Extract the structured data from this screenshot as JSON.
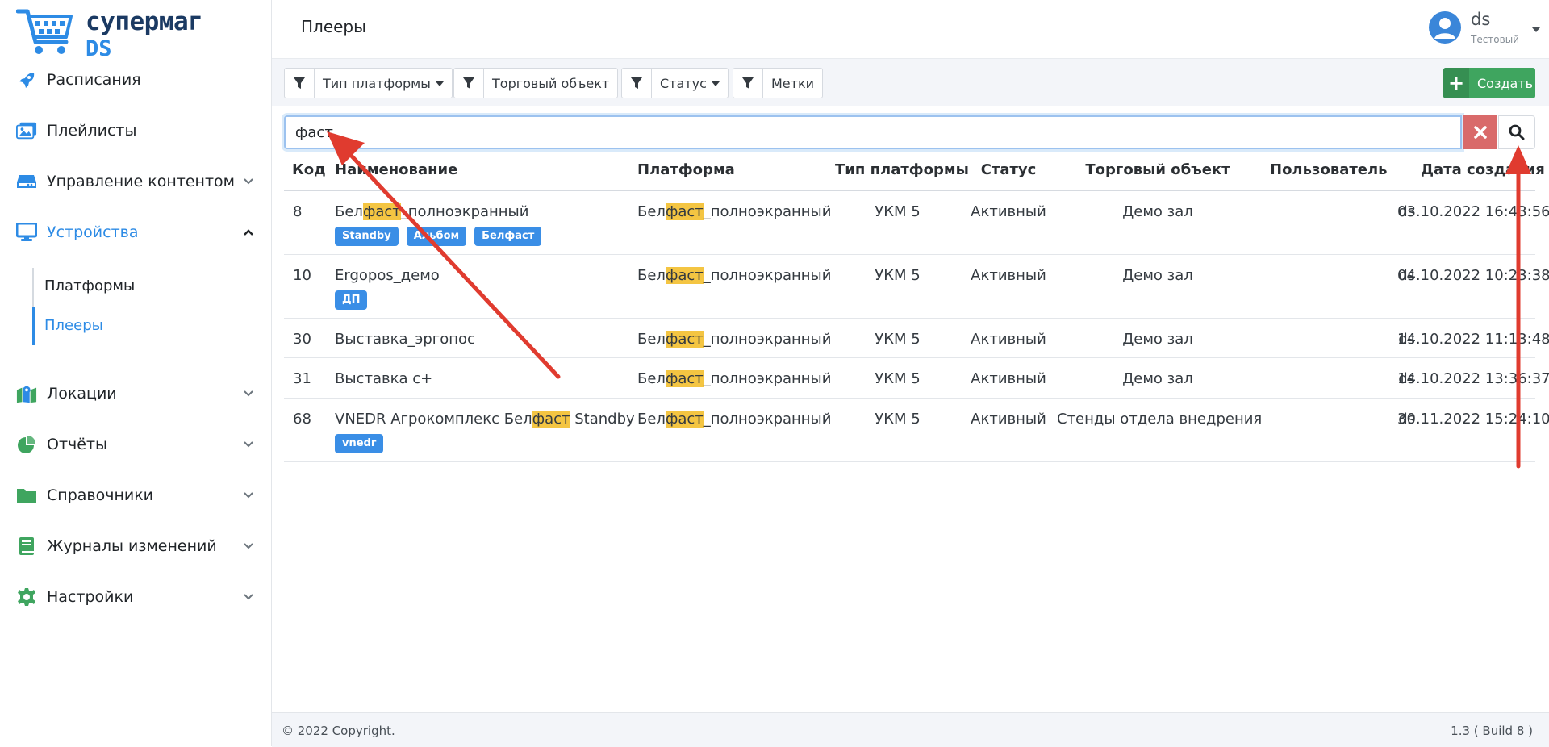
{
  "app": {
    "logo_line1": "супермаг",
    "logo_line2": "DS"
  },
  "sidebar": {
    "items": [
      {
        "label": "Расписания",
        "icon": "rocket-icon"
      },
      {
        "label": "Плейлисты",
        "icon": "images-icon"
      },
      {
        "label": "Управление контентом",
        "icon": "hdd-icon"
      },
      {
        "label": "Устройства",
        "icon": "desktop-icon"
      },
      {
        "label": "Локации",
        "icon": "map-icon"
      },
      {
        "label": "Отчёты",
        "icon": "pie-chart-icon"
      },
      {
        "label": "Справочники",
        "icon": "folder-icon"
      },
      {
        "label": "Журналы изменений",
        "icon": "book-icon"
      },
      {
        "label": "Настройки",
        "icon": "gear-icon"
      }
    ],
    "sub_items": [
      {
        "label": "Платформы"
      },
      {
        "label": "Плееры"
      }
    ]
  },
  "header": {
    "title": "Плееры",
    "user_name": "ds",
    "user_role": "Тестовый"
  },
  "toolbar": {
    "filters": [
      {
        "label": "Тип платформы"
      },
      {
        "label": "Торговый объект"
      },
      {
        "label": "Статус"
      },
      {
        "label": "Метки"
      }
    ],
    "create_label": "Создать"
  },
  "search": {
    "value": "фаст"
  },
  "table": {
    "columns": [
      "Код",
      "Наименование",
      "Платформа",
      "Тип платформы",
      "Статус",
      "Торговый объект",
      "Пользователь",
      "Дата создания"
    ],
    "rows": [
      {
        "code": "8",
        "name_pre": "Бел",
        "name_hl": "фаст",
        "name_post": "_полноэкранный",
        "platform_pre": "Бел",
        "platform_hl": "фаст",
        "platform_post": "_полноэкранный",
        "type": "УКМ 5",
        "status": "Активный",
        "object": "Демо зал",
        "user": "ds",
        "date": "03.10.2022 16:43:56",
        "tags": [
          "Standby",
          "Альбом",
          "Белфаст"
        ]
      },
      {
        "code": "10",
        "name_pre": "Ergopos_демо",
        "name_hl": "",
        "name_post": "",
        "platform_pre": "Бел",
        "platform_hl": "фаст",
        "platform_post": "_полноэкранный",
        "type": "УКМ 5",
        "status": "Активный",
        "object": "Демо зал",
        "user": "ds",
        "date": "04.10.2022 10:23:38",
        "tags": [
          "ДП"
        ]
      },
      {
        "code": "30",
        "name_pre": "Выставка_эргопос",
        "name_hl": "",
        "name_post": "",
        "platform_pre": "Бел",
        "platform_hl": "фаст",
        "platform_post": "_полноэкранный",
        "type": "УКМ 5",
        "status": "Активный",
        "object": "Демо зал",
        "user": "ds",
        "date": "14.10.2022 11:13:48",
        "tags": []
      },
      {
        "code": "31",
        "name_pre": "Выставка с+",
        "name_hl": "",
        "name_post": "",
        "platform_pre": "Бел",
        "platform_hl": "фаст",
        "platform_post": "_полноэкранный",
        "type": "УКМ 5",
        "status": "Активный",
        "object": "Демо зал",
        "user": "ds",
        "date": "14.10.2022 13:36:37",
        "tags": []
      },
      {
        "code": "68",
        "name_pre": "VNEDR Агрокомплекс Бел",
        "name_hl": "фаст",
        "name_post": " Standby",
        "platform_pre": "Бел",
        "platform_hl": "фаст",
        "platform_post": "_полноэкранный",
        "type": "УКМ 5",
        "status": "Активный",
        "object": "Стенды отдела внедрения",
        "user": "ds",
        "date": "30.11.2022 15:24:10",
        "tags": [
          "vnedr"
        ]
      }
    ]
  },
  "footer": {
    "copyright": "© 2022 Copyright.",
    "build": "1.3 ( Build 8 )"
  },
  "colors": {
    "accent": "#2d8be5",
    "highlight": "#f4c542",
    "success": "#3fa55f",
    "danger": "#d96a6a",
    "annotation": "#e03b2f"
  }
}
